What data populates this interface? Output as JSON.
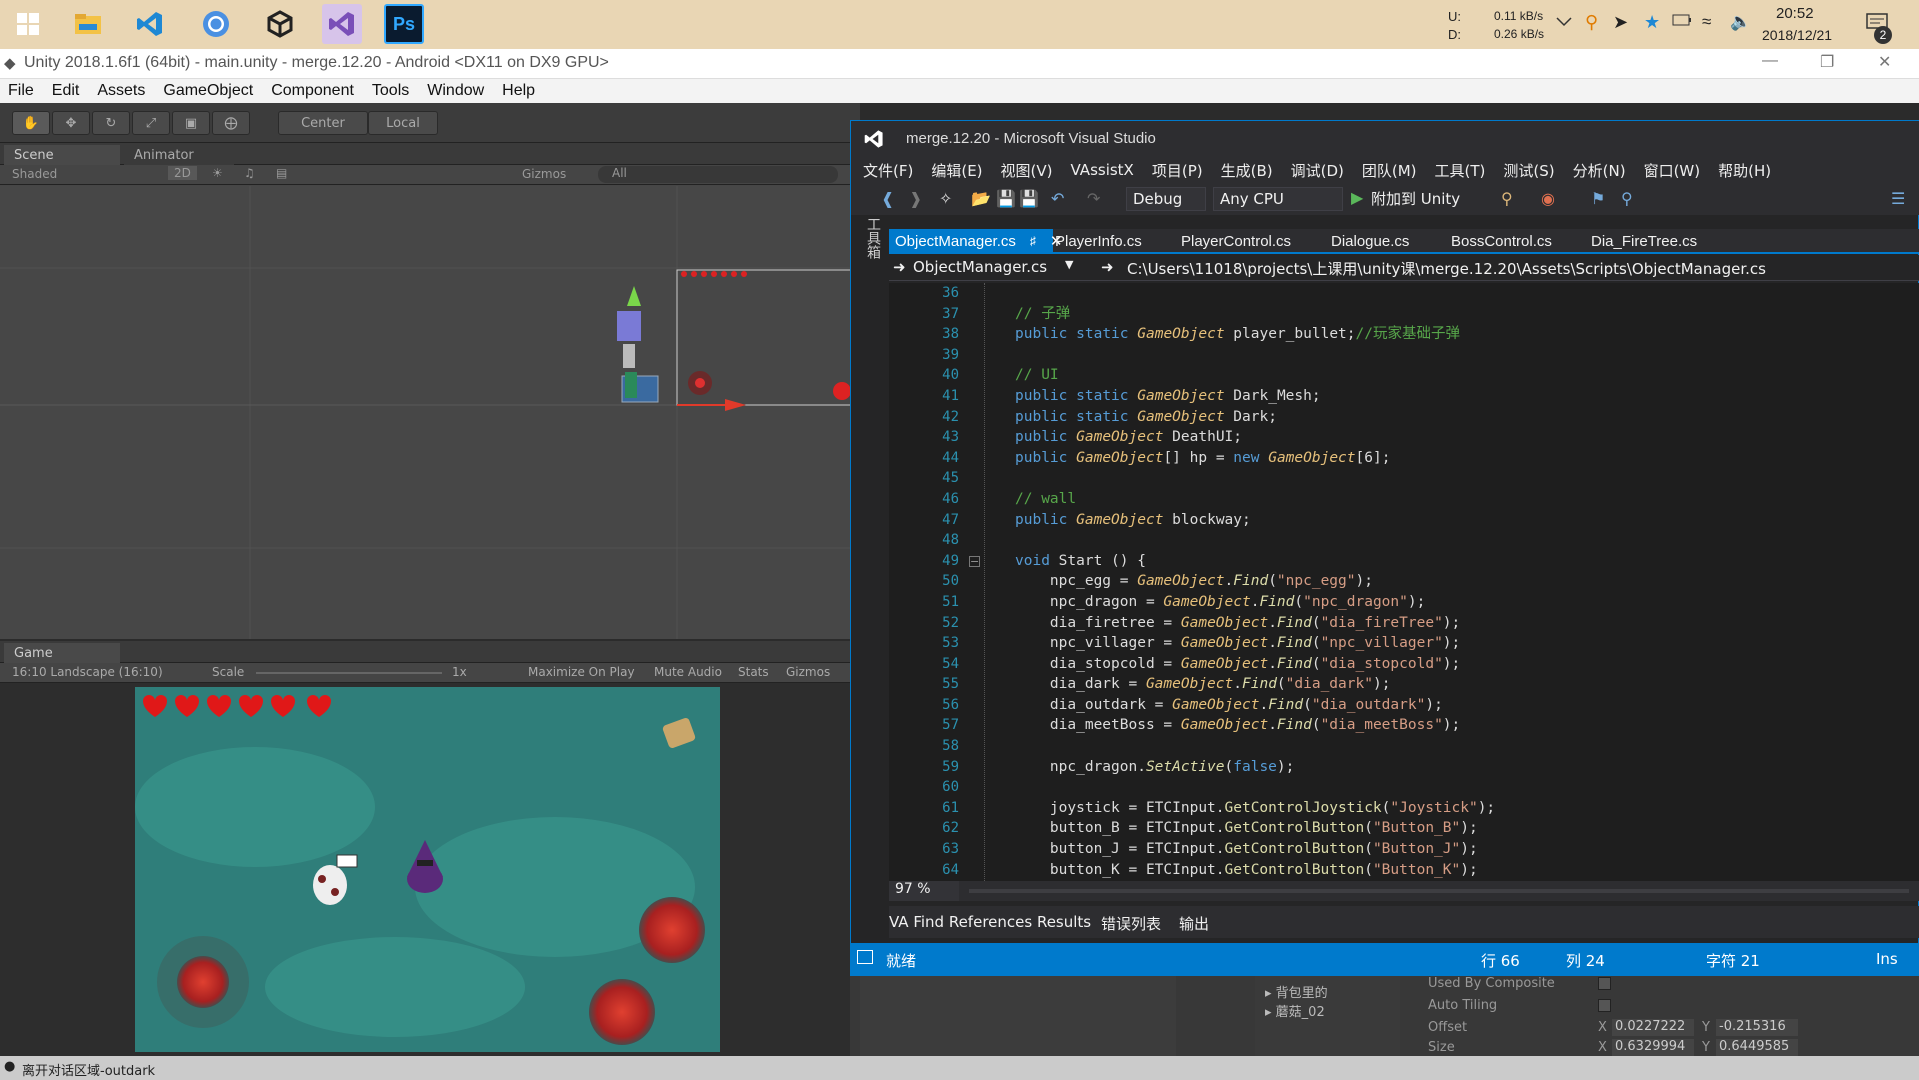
{
  "taskbar": {
    "net_up_label": "U:",
    "net_down_label": "D:",
    "net_up": "0.11 kB/s",
    "net_down": "0.26 kB/s",
    "time": "20:52",
    "date": "2018/12/21",
    "notification_count": "2"
  },
  "unity": {
    "title": "Unity 2018.1.6f1 (64bit) - main.unity - merge.12.20 - Android <DX11 on DX9 GPU>",
    "menu": [
      "File",
      "Edit",
      "Assets",
      "GameObject",
      "Component",
      "Tools",
      "Window",
      "Help"
    ],
    "toolbar": {
      "center_label": "Center",
      "local_label": "Local"
    },
    "scene_tab": "Scene",
    "animator_tab": "Animator",
    "shaded": "Shaded",
    "mode_2d": "2D",
    "gizmos": "Gizmos",
    "search_all": "All",
    "game_tab": "Game",
    "aspect": "16:10 Landscape (16:10)",
    "scale_label": "Scale",
    "scale_value": "1x",
    "maximize": "Maximize On Play",
    "mute": "Mute Audio",
    "stats": "Stats",
    "game_gizmos": "Gizmos",
    "status_message": "离开对话区域-outdark",
    "hierarchy_items": [
      "背包里的",
      "蘑菇_02"
    ],
    "inspector": {
      "used_by_composite": "Used By Composite",
      "auto_tiling": "Auto Tiling",
      "offset_label": "Offset",
      "offset_x": "0.0227222",
      "offset_y": "-0.215316",
      "size_label": "Size",
      "size_x": "0.6329994",
      "size_y": "0.6449585"
    }
  },
  "vs": {
    "title": "merge.12.20 - Microsoft Visual Studio",
    "menu": [
      "文件(F)",
      "编辑(E)",
      "视图(V)",
      "VAssistX",
      "项目(P)",
      "生成(B)",
      "调试(D)",
      "团队(M)",
      "工具(T)",
      "测试(S)",
      "分析(N)",
      "窗口(W)",
      "帮助(H)"
    ],
    "config": "Debug",
    "platform": "Any CPU",
    "attach": "附加到 Unity",
    "side_label": "工具箱",
    "tabs": [
      "ObjectManager.cs",
      "PlayerInfo.cs",
      "PlayerControl.cs",
      "Dialogue.cs",
      "BossControl.cs",
      "Dia_FireTree.cs"
    ],
    "nav_file": "ObjectManager.cs",
    "nav_path": "C:\\Users\\11018\\projects\\上课用\\unity课\\merge.12.20\\Assets\\Scripts\\ObjectManager.cs",
    "zoom": "97 %",
    "bottom_tabs": [
      "VA Find References Results",
      "错误列表",
      "输出"
    ],
    "status": {
      "ready": "就绪",
      "line": "行 66",
      "col": "列 24",
      "char": "字符 21",
      "ins": "Ins"
    },
    "line_numbers": [
      "36",
      "37",
      "38",
      "39",
      "40",
      "41",
      "42",
      "43",
      "44",
      "45",
      "46",
      "47",
      "48",
      "49",
      "50",
      "51",
      "52",
      "53",
      "54",
      "55",
      "56",
      "57",
      "58",
      "59",
      "60",
      "61",
      "62",
      "63",
      "64"
    ]
  }
}
